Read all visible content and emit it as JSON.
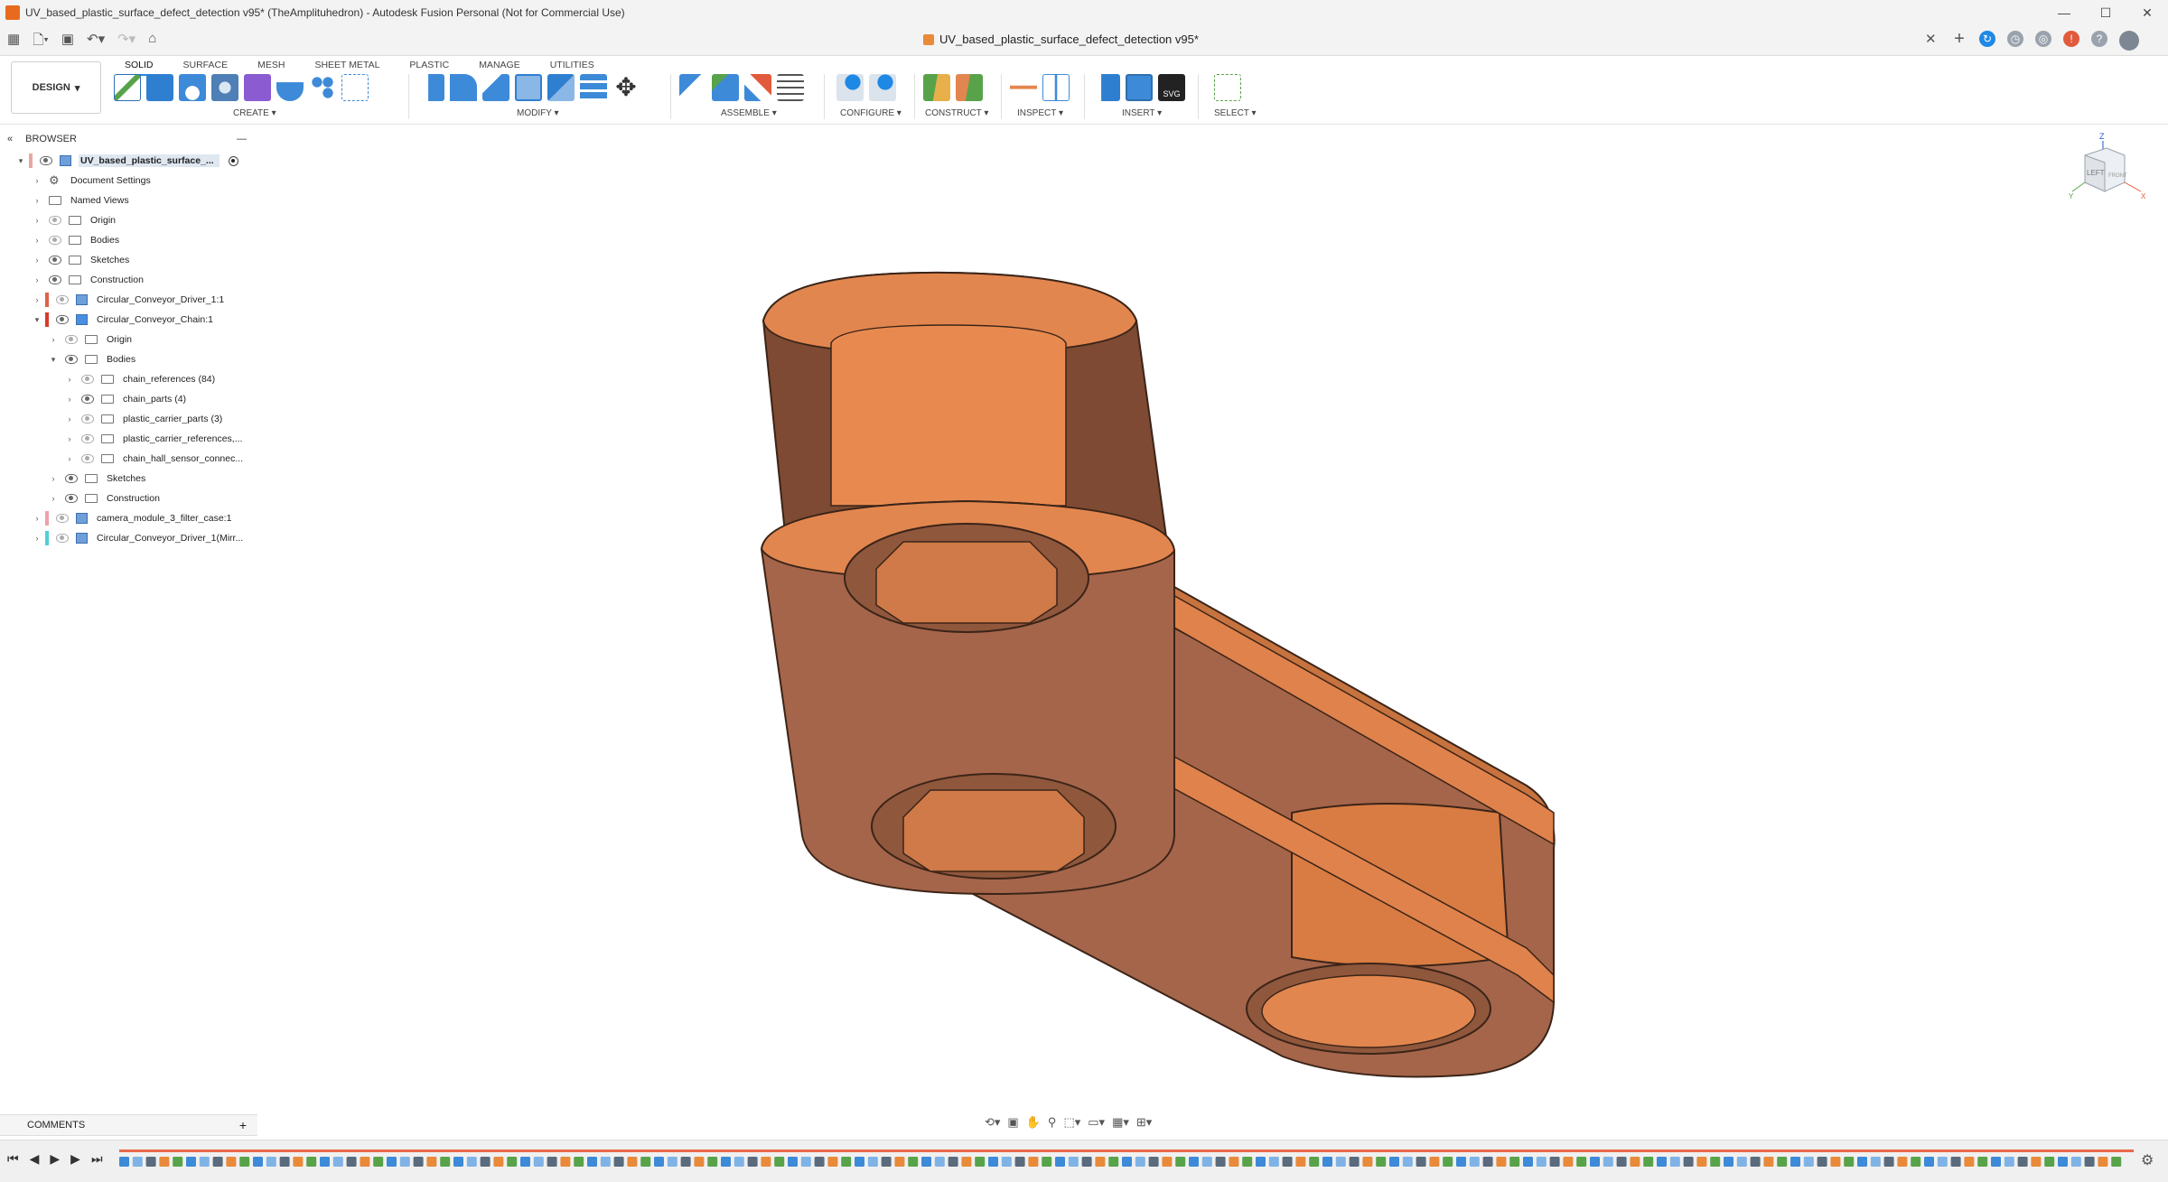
{
  "window": {
    "title": "UV_based_plastic_surface_defect_detection v95* (TheAmplituhedron) - Autodesk Fusion Personal (Not for Commercial Use)",
    "controls": [
      "—",
      "☐",
      "✕"
    ]
  },
  "document_tab": {
    "name": "UV_based_plastic_surface_defect_detection v95*"
  },
  "workspace": {
    "mode": "DESIGN",
    "tabs": [
      "SOLID",
      "SURFACE",
      "MESH",
      "SHEET METAL",
      "PLASTIC",
      "MANAGE",
      "UTILITIES"
    ],
    "active_tab": "SOLID"
  },
  "toolbar_groups": {
    "create": "CREATE",
    "modify": "MODIFY",
    "assemble": "ASSEMBLE",
    "configure": "CONFIGURE",
    "construct": "CONSTRUCT",
    "inspect": "INSPECT",
    "insert": "INSERT",
    "select": "SELECT"
  },
  "browser": {
    "title": "BROWSER",
    "root": "UV_based_plastic_surface_...",
    "items": [
      {
        "label": "Document Settings"
      },
      {
        "label": "Named Views"
      },
      {
        "label": "Origin"
      },
      {
        "label": "Bodies"
      },
      {
        "label": "Sketches"
      },
      {
        "label": "Construction"
      },
      {
        "label": "Circular_Conveyor_Driver_1:1"
      },
      {
        "label": "Circular_Conveyor_Chain:1"
      },
      {
        "label": "Origin"
      },
      {
        "label": "Bodies"
      },
      {
        "label": "chain_references (84)"
      },
      {
        "label": "chain_parts (4)"
      },
      {
        "label": "plastic_carrier_parts (3)"
      },
      {
        "label": "plastic_carrier_references,..."
      },
      {
        "label": "chain_hall_sensor_connec..."
      },
      {
        "label": "Sketches"
      },
      {
        "label": "Construction"
      },
      {
        "label": "camera_module_3_filter_case:1"
      },
      {
        "label": "Circular_Conveyor_Driver_1(Mirr..."
      }
    ]
  },
  "viewcube": {
    "face_left": "LEFT",
    "face_front": "FRONT",
    "axis_z": "Z",
    "axis_y": "Y",
    "axis_x": "X"
  },
  "comments": {
    "label": "COMMENTS"
  },
  "colors": {
    "accent": "#1e88e5",
    "part_face": "#a5654a",
    "part_light": "#e2864f",
    "part_mid": "#c7733f",
    "part_dark": "#7e4a33"
  }
}
